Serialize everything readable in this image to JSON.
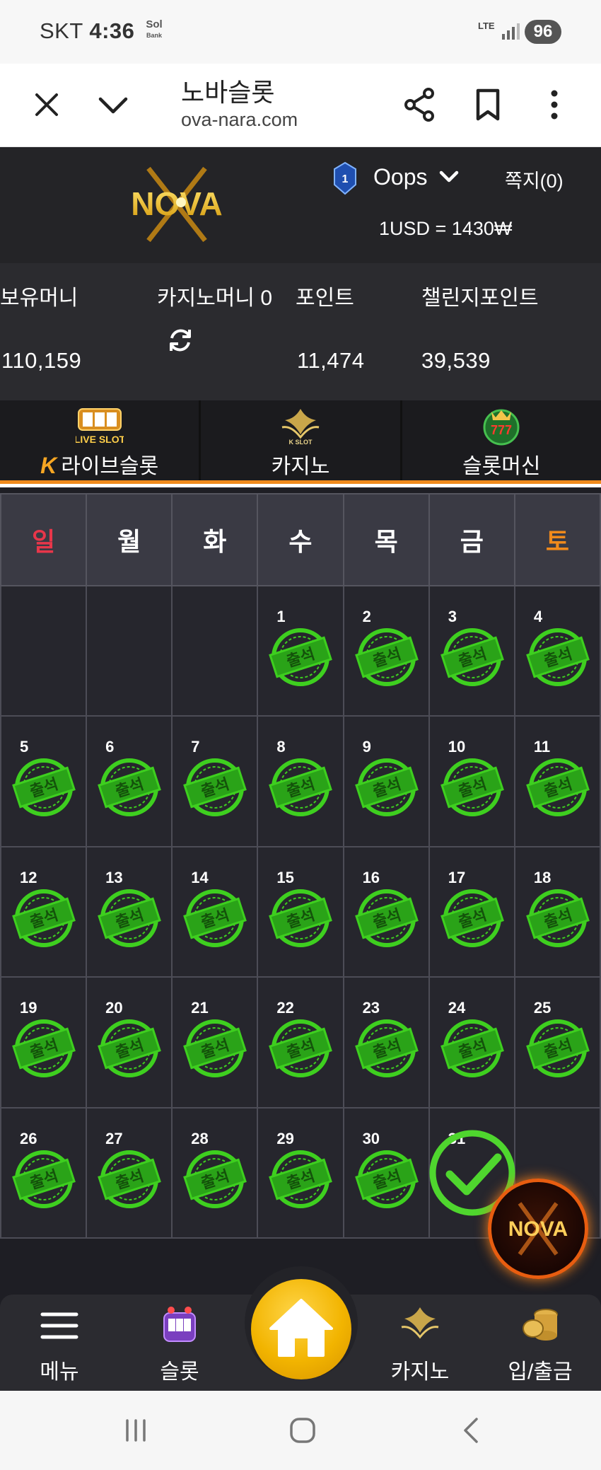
{
  "status_bar": {
    "carrier": "SKT",
    "time": "4:36",
    "bank_icon_text": "Sol",
    "bank_icon_sub": "Bank",
    "network": "LTE",
    "battery": "96"
  },
  "browser": {
    "title": "노바슬롯",
    "url": "ova-nara.com",
    "icons": [
      "close-icon",
      "chevron-down-icon",
      "share-icon",
      "bookmark-icon",
      "more-vert-icon"
    ]
  },
  "header": {
    "logo_text": "NOVA",
    "level": "1",
    "username": "Oops",
    "messages": "쪽지(0)",
    "exchange_rate": "1USD = 1430₩"
  },
  "balances": {
    "holding_label": "보유머니",
    "holding_value": "110,159",
    "casino_label": "카지노머니 0",
    "point_label": "포인트",
    "point_value": "11,474",
    "challenge_label": "챌린지포인트",
    "challenge_value": "39,539"
  },
  "game_tabs": [
    {
      "label": "라이브슬롯",
      "prefix": "K",
      "icon": "live-slot-icon",
      "icon_text": "LIVE SLOT"
    },
    {
      "label": "카지노",
      "icon": "k-slot-casino-icon",
      "icon_text": "K SLOT"
    },
    {
      "label": "슬롯머신",
      "icon": "777-slots-icon",
      "icon_text": "777"
    }
  ],
  "calendar": {
    "weekdays": [
      "일",
      "월",
      "화",
      "수",
      "목",
      "금",
      "토"
    ],
    "stamp_text": "출석",
    "weeks": [
      [
        "",
        "",
        "",
        "1",
        "2",
        "3",
        "4"
      ],
      [
        "5",
        "6",
        "7",
        "8",
        "9",
        "10",
        "11"
      ],
      [
        "12",
        "13",
        "14",
        "15",
        "16",
        "17",
        "18"
      ],
      [
        "19",
        "20",
        "21",
        "22",
        "23",
        "24",
        "25"
      ],
      [
        "26",
        "27",
        "28",
        "29",
        "30",
        "31",
        ""
      ]
    ],
    "checked_day": "31"
  },
  "bottom_nav": {
    "menu": "메뉴",
    "slot": "슬롯",
    "casino": "카지노",
    "cash": "입/출금",
    "fab_logo_text": "NOVA"
  },
  "colors": {
    "accent_orange": "#f08a1c",
    "stamp_green": "#3ecf1f",
    "sunday_red": "#e8364a",
    "home_gold": "#f2b400"
  }
}
